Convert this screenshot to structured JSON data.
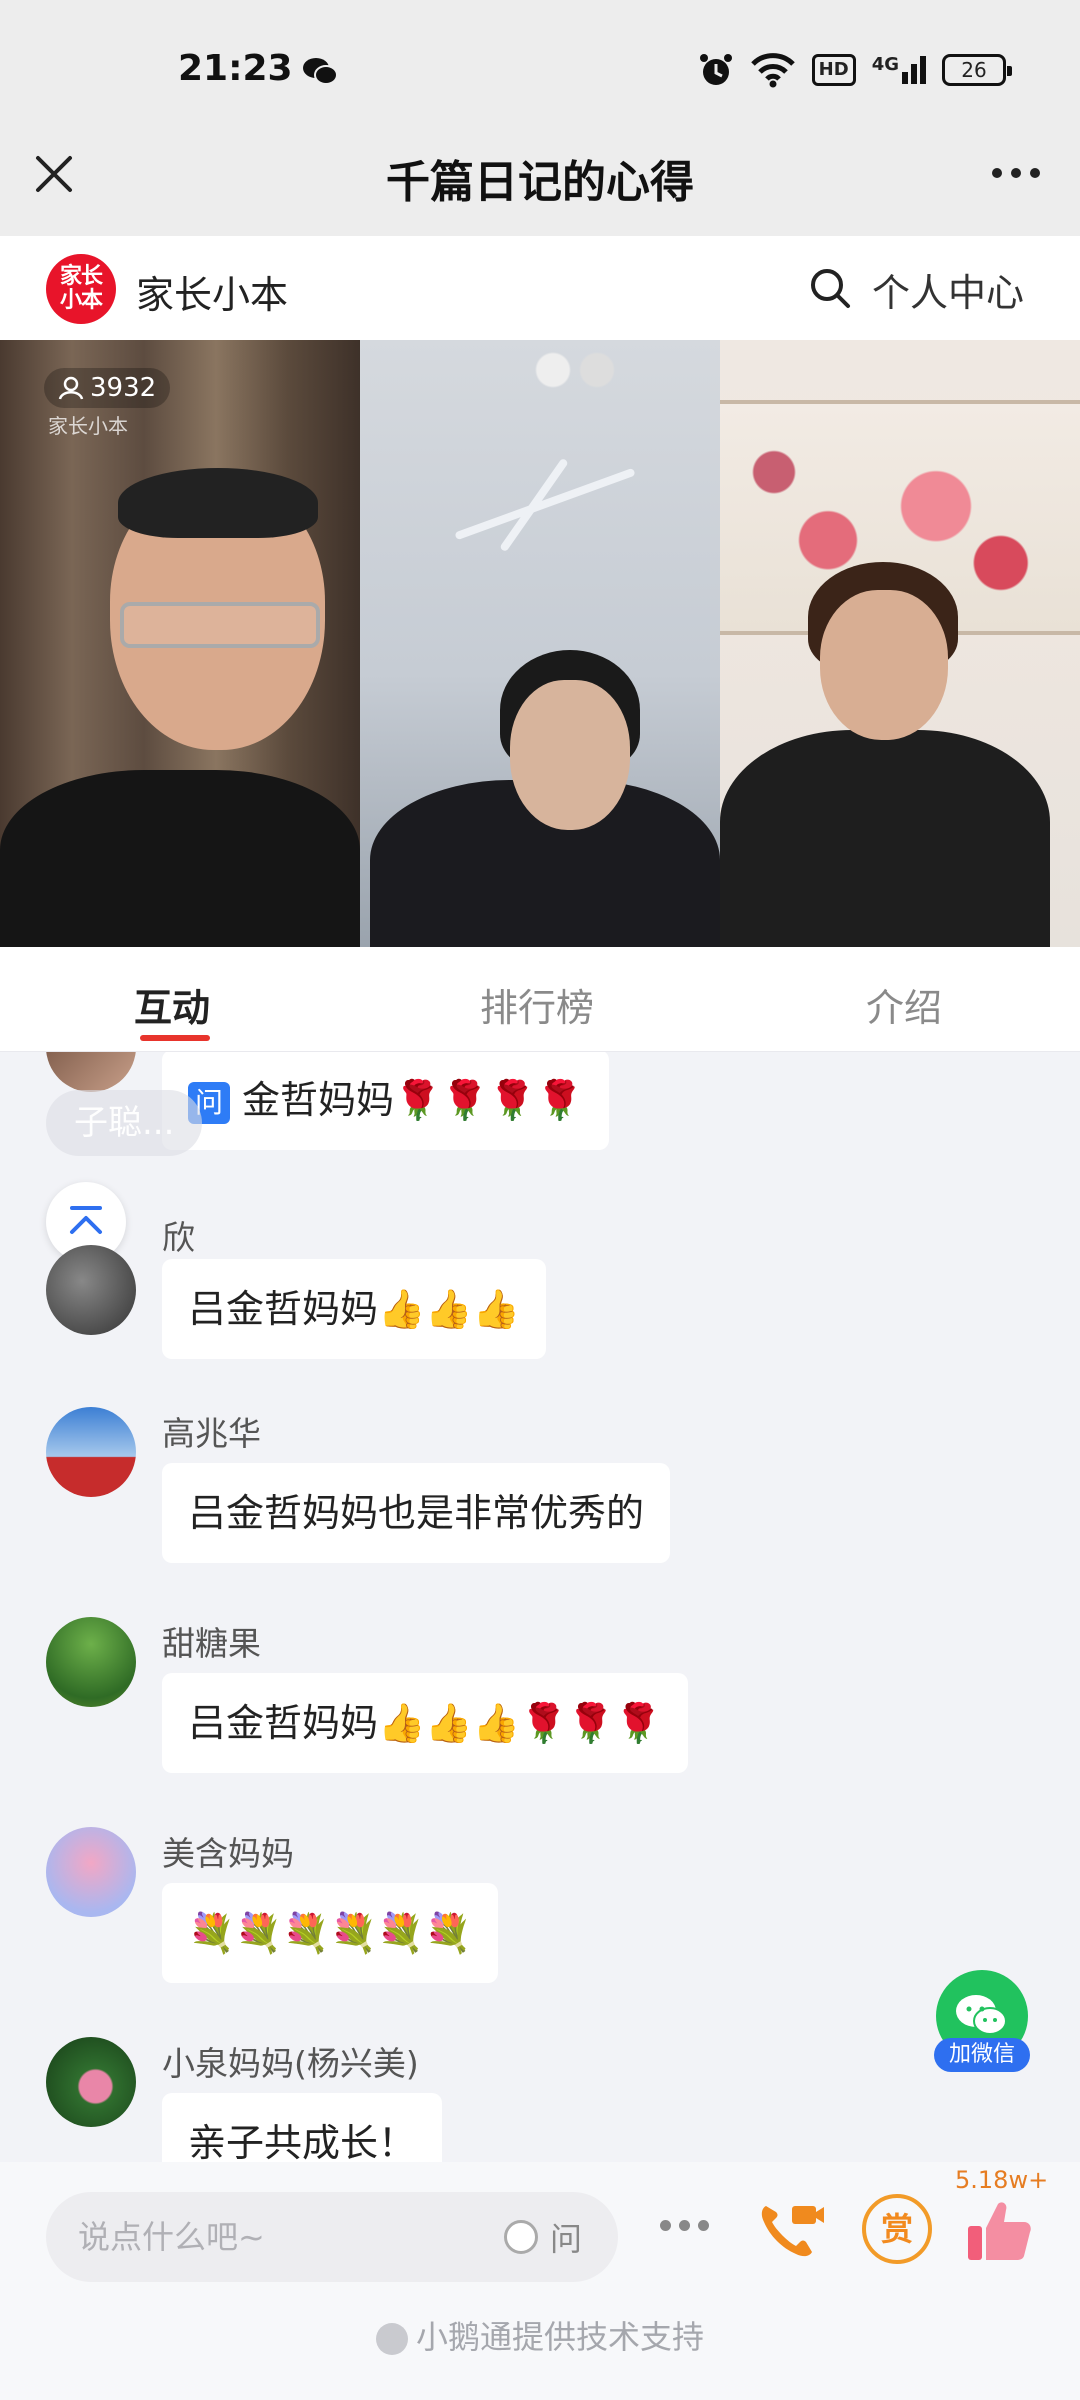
{
  "status_bar": {
    "time": "21:23",
    "network": "4G",
    "hd_label": "HD",
    "battery": "26"
  },
  "nav": {
    "title": "千篇日记的心得"
  },
  "header": {
    "logo_text": "家长小本",
    "brand": "家长小本",
    "personal_center": "个人中心"
  },
  "video": {
    "viewer_count": "3932",
    "watermark": "家长小本"
  },
  "tabs": [
    {
      "label": "互动",
      "active": true
    },
    {
      "label": "排行榜",
      "active": false
    },
    {
      "label": "介绍",
      "active": false
    }
  ],
  "chat": {
    "notice": "子聪...",
    "messages": [
      {
        "user": "",
        "text": "金哲妈妈🌹🌹🌹🌹",
        "question": true,
        "question_label": "问"
      },
      {
        "user": "欣",
        "text": "吕金哲妈妈👍👍👍"
      },
      {
        "user": "高兆华",
        "text": "吕金哲妈妈也是非常优秀的"
      },
      {
        "user": "甜糖果",
        "text": "吕金哲妈妈👍👍👍🌹🌹🌹"
      },
      {
        "user": "美含妈妈",
        "text": "💐💐💐💐💐💐"
      },
      {
        "user": "小泉妈妈(杨兴美)",
        "text": "亲子共成长！"
      }
    ]
  },
  "add_wechat": {
    "label": "加微信"
  },
  "bottom": {
    "input_placeholder": "说点什么吧~",
    "ask_label": "问",
    "reward_label": "赏",
    "like_count": "5.18w+",
    "support_text": "小鹅通提供技术支持"
  },
  "colors": {
    "accent_red": "#e8342c",
    "wechat_green": "#21c25e",
    "reward_orange": "#f29b28",
    "question_blue": "#2e7cf6"
  }
}
